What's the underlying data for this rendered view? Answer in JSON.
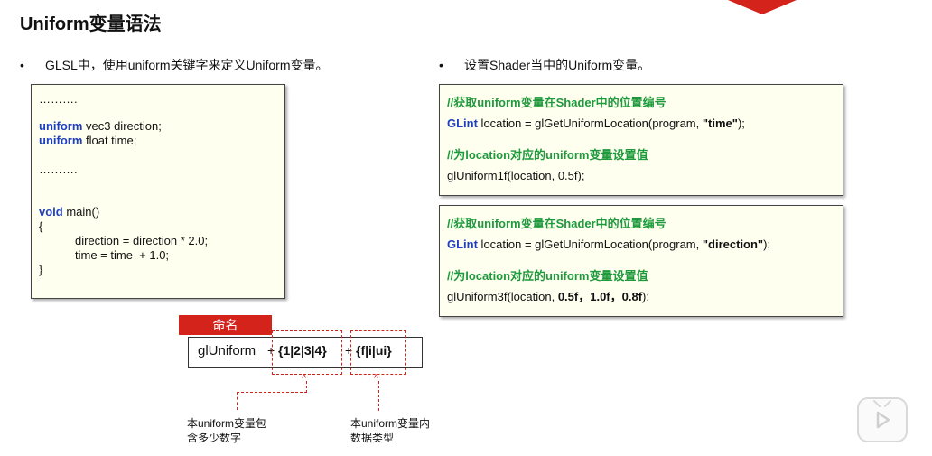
{
  "title": "Uniform变量语法",
  "left": {
    "bullet": "GLSL中，使用uniform关键字来定义Uniform变量。",
    "code": {
      "dots1": "……….",
      "uniform_kw1": "uniform",
      "line1_rest": " vec3 direction;",
      "uniform_kw2": "uniform",
      "line2_rest": " float time;",
      "dots2": "……….",
      "void_kw": "void",
      "main_rest": " main()",
      "brace_open": "{",
      "stmt1": "direction = direction * 2.0;",
      "stmt2": "time = time  + 1.0;",
      "brace_close": "}"
    }
  },
  "right": {
    "bullet": "设置Shader当中的Uniform变量。",
    "box1": {
      "comment1": "//获取uniform变量在Shader中的位置编号",
      "glint": "GLint",
      "loc_rest": " location = glGetUniformLocation(program, ",
      "name": "\"time\"",
      "tail": ");",
      "comment2": "//为location对应的uniform变量设置值",
      "set_call": "glUniform1f(location, 0.5f);"
    },
    "box2": {
      "comment1": "//获取uniform变量在Shader中的位置编号",
      "glint": "GLint",
      "loc_rest": " location = glGetUniformLocation(program, ",
      "name": "\"direction\"",
      "tail": ");",
      "comment2": "//为location对应的uniform变量设置值",
      "set_prefix": "glUniform3f(location, ",
      "set_values": "0.5f，1.0f，0.8f",
      "set_suffix": ");"
    }
  },
  "naming": {
    "tag": "命名",
    "base": "glUniform",
    "plus1": "+",
    "count": "{1|2|3|4}",
    "plus2": "+",
    "type": "{f|i|ui}",
    "note_count": [
      "本uniform变量包",
      "含多少数字"
    ],
    "note_type": [
      "本uniform变量内",
      "数据类型"
    ]
  },
  "icons": {
    "play": "play-icon"
  },
  "colors": {
    "accent": "#d3231b",
    "keyword": "#1f3fbf",
    "comment": "#1e9a3c"
  }
}
